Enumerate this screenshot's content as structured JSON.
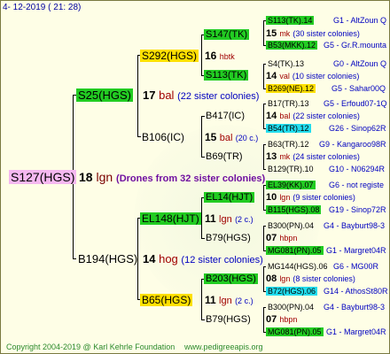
{
  "header": "4- 12-2019 ( 21: 28)",
  "footer": {
    "copyright": "Copyright 2004-2019 @ Karl Kehrle Foundation",
    "site": "www.pedigreeapis.org"
  },
  "colors": {
    "pink": "#f5b8f0",
    "green": "#22cc22",
    "yellow": "#ffe000",
    "cyan": "#22ddee",
    "footer": "#2c8a2c"
  },
  "root": {
    "name": "S127(HGS)",
    "num": "18",
    "race": "lgn",
    "note": "(Drones from 32 sister colonies)"
  },
  "sire": {
    "name": "S25(HGS)",
    "num": "17",
    "race": "bal",
    "note": "(22 sister colonies)",
    "sire": {
      "name": "S292(HGS)",
      "num": "16",
      "race": "hbtk",
      "sire": {
        "name": "S147(TK)",
        "num": "15",
        "race": "mk",
        "note": "(30 sister colonies)",
        "sire": {
          "name": "S113(TK).14",
          "right": "G1 - AltZoun Q"
        },
        "dam": {
          "name": "B53(MKK).12",
          "right": "G5 - Gr.R.mounta"
        }
      },
      "dam": {
        "name": "S113(TK)",
        "num": "14",
        "race": "val",
        "note": "(10 sister colonies)",
        "sire": {
          "name": "S4(TK).13",
          "right": "G0 - AltZoun Q"
        },
        "dam": {
          "name": "B269(NE).12",
          "right": "G5 - Sahar00Q"
        }
      }
    },
    "dam": {
      "name": "B106(IC)",
      "num": "15",
      "race": "bal",
      "note": "(20 c.)",
      "sire": {
        "name": "B417(IC)",
        "num": "14",
        "race": "bal",
        "note": "(22 sister colonies)",
        "sire": {
          "name": "B17(TR).13",
          "right": "G5 - Erfoud07-1Q"
        },
        "dam": {
          "name": "B54(TR).12",
          "right": "G26 - Sinop62R"
        }
      },
      "dam": {
        "name": "B69(TR)",
        "num": "13",
        "race": "mk",
        "note": "(24 sister colonies)",
        "sire": {
          "name": "B63(TR).12",
          "right": "G9 - Kangaroo98R"
        },
        "dam": {
          "name": "B129(TR).10",
          "right": "G10 - N06294R"
        }
      }
    }
  },
  "dam": {
    "name": "B194(HGS)",
    "num": "14",
    "race": "hog",
    "note": "(12 sister colonies)",
    "sire": {
      "name": "EL148(HJT)",
      "num": "11",
      "race": "lgn",
      "note": "(2 c.)",
      "sire": {
        "name": "EL14(HJT)",
        "num": "10",
        "race": "lgn",
        "note": "(9 sister colonies)",
        "sire": {
          "name": "EL39(KK).07",
          "right": "G6 - not registe"
        },
        "dam": {
          "name": "B115(HGS).08",
          "right": "G19 - Sinop72R"
        }
      },
      "dam": {
        "name": "B79(HGS)",
        "num": "07",
        "race": "hbpn",
        "sire": {
          "name": "B300(PN).04",
          "right": "G4 - Bayburt98-3"
        },
        "dam": {
          "name": "MG081(PN).05",
          "right": "G1 - Margret04R"
        }
      }
    },
    "dam": {
      "name": "B65(HGS)",
      "num": "11",
      "race": "lgn",
      "note": "(2 c.)",
      "sire": {
        "name": "B203(HGS)",
        "num": "08",
        "race": "lgn",
        "note": "(8 sister colonies)",
        "sire": {
          "name": "MG144(HGS).06",
          "right": "G6 - MG00R"
        },
        "dam": {
          "name": "B72(HGS).06",
          "right": "G14 - AthosSt80R"
        }
      },
      "dam": {
        "name": "B79(HGS)",
        "num": "07",
        "race": "hbpn",
        "sire": {
          "name": "B300(PN).04",
          "right": "G4 - Bayburt98-3"
        },
        "dam": {
          "name": "MG081(PN).05",
          "right": "G1 - Margret04R"
        }
      }
    }
  }
}
